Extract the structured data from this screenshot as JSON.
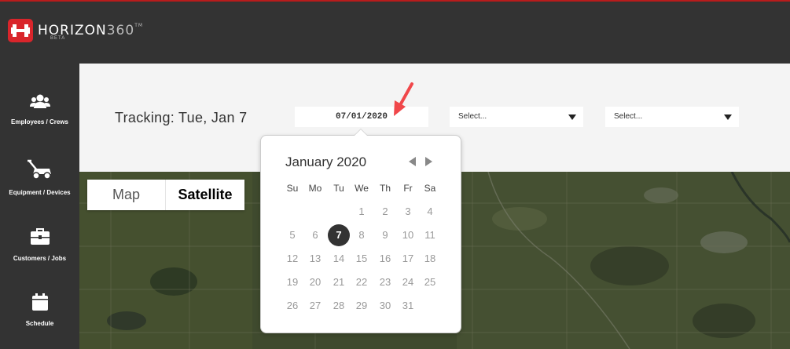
{
  "brand": {
    "name_bold": "HORIZON",
    "name_light": "360",
    "tm": "TM",
    "subtitle": "BETA"
  },
  "sidebar": {
    "items": [
      {
        "label": "Employees / Crews",
        "icon": "people-icon"
      },
      {
        "label": "Equipment / Devices",
        "icon": "lawnmower-icon"
      },
      {
        "label": "Customers / Jobs",
        "icon": "briefcase-icon"
      },
      {
        "label": "Schedule",
        "icon": "calendar-icon"
      }
    ]
  },
  "header": {
    "tracking_text": "Tracking: Tue, Jan 7",
    "date_value": "07/01/2020",
    "select1": "Select...",
    "select2": "Select..."
  },
  "map_toggle": {
    "map": "Map",
    "satellite": "Satellite",
    "active": "Satellite"
  },
  "calendar": {
    "month_title": "January 2020",
    "weekdays": [
      "Su",
      "Mo",
      "Tu",
      "We",
      "Th",
      "Fr",
      "Sa"
    ],
    "weeks": [
      [
        "",
        "",
        "",
        "1",
        "2",
        "3",
        "4"
      ],
      [
        "5",
        "6",
        "7",
        "8",
        "9",
        "10",
        "11"
      ],
      [
        "12",
        "13",
        "14",
        "15",
        "16",
        "17",
        "18"
      ],
      [
        "19",
        "20",
        "21",
        "22",
        "23",
        "24",
        "25"
      ],
      [
        "26",
        "27",
        "28",
        "29",
        "30",
        "31",
        ""
      ]
    ],
    "selected_day": "7"
  },
  "colors": {
    "brand_red": "#d9252b",
    "sidebar_bg": "#333333",
    "accent_arrow": "#f0474a"
  }
}
